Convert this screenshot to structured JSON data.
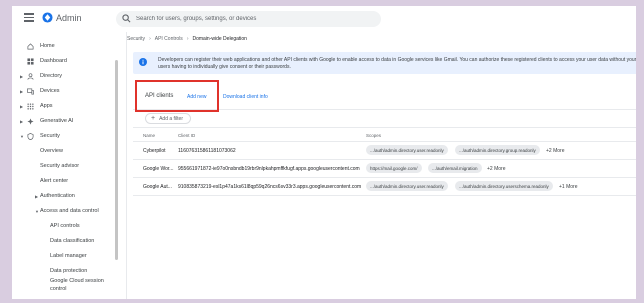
{
  "app": {
    "title": "Admin"
  },
  "search": {
    "placeholder": "Search for users, groups, settings, or devices"
  },
  "sidebar": {
    "items": [
      {
        "label": "Home"
      },
      {
        "label": "Dashboard"
      },
      {
        "label": "Directory"
      },
      {
        "label": "Devices"
      },
      {
        "label": "Apps"
      },
      {
        "label": "Generative AI"
      },
      {
        "label": "Security"
      },
      {
        "label": "Overview"
      },
      {
        "label": "Security advisor"
      },
      {
        "label": "Alert center"
      },
      {
        "label": "Authentication"
      },
      {
        "label": "Access and data control"
      },
      {
        "label": "API controls"
      },
      {
        "label": "Data classification"
      },
      {
        "label": "Label manager"
      },
      {
        "label": "Data protection"
      },
      {
        "label": "Google Cloud session"
      },
      {
        "label": "control"
      }
    ]
  },
  "breadcrumb": {
    "items": [
      "Security",
      "API Controls"
    ],
    "current": "Domain-wide Delegation"
  },
  "banner": {
    "text": "Developers can register their web applications and other API clients with Google to enable access to data in Google services like Gmail. You can authorize these registered clients to access your user data without your users having to individually give consent or their passwords."
  },
  "panel": {
    "title": "API clients",
    "add_new": "Add new",
    "download": "Download client info",
    "add_filter": "Add a filter"
  },
  "table": {
    "headers": {
      "name": "Name",
      "client_id": "Client ID",
      "scopes": "Scopes"
    },
    "rows": [
      {
        "name": "Cyberpilot",
        "client_id": "116076315861181073062",
        "scope1": ".../auth/admin.directory.user.readonly",
        "scope2": ".../auth/admin.directory.group.readonly",
        "more": "+2 More"
      },
      {
        "name": "Google Wor...",
        "client_id": "955661971872-ie97o0nsbndb19rbr9nlpkahpmffkfugf.apps.googleusercontent.com",
        "scope1": "https://mail.google.com/",
        "scope2": ".../auth/email.migration",
        "more": "+2 More"
      },
      {
        "name": "Google Aut...",
        "client_id": "910835873219-esl1p47a1ks61l8qp59q26ncs6sv33r3.apps.googleusercontent.com",
        "scope1": ".../auth/admin.directory.user.readonly",
        "scope2": ".../auth/admin.directory.userschema.readonly",
        "more": "+1 More"
      }
    ]
  },
  "colors": {
    "accent": "#1a73e8",
    "highlight": "#e0322b",
    "banner_bg": "#e8f0fe",
    "page_bg": "#d9cde0"
  }
}
